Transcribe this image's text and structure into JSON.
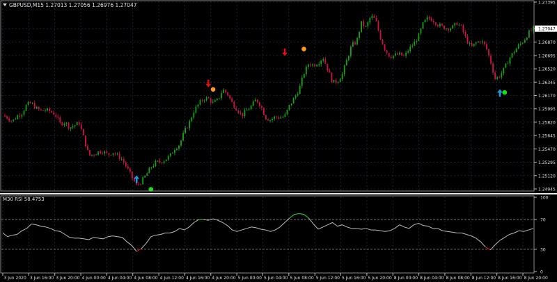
{
  "main": {
    "symbol_info": "GBPUSD,M15  1.27013 1.27056 1.26976 1.27047",
    "price_labels": [
      "1.27395",
      "1.27047",
      "1.26870",
      "1.26695",
      "1.26520",
      "1.26345",
      "1.26170",
      "1.25995",
      "1.25820",
      "1.25645",
      "1.25470",
      "1.25295",
      "1.25120",
      "1.24945"
    ],
    "current_price": "1.27047"
  },
  "indicator": {
    "label": "M30 RSI 58.4753",
    "levels": [
      "100",
      "70",
      "30",
      "0"
    ]
  },
  "time_labels": [
    "3 Jun 2020",
    "3 Jun 16:00",
    "3 Jun 20:00",
    "4 Jun 00:00",
    "4 Jun 04:00",
    "4 Jun 08:00",
    "4 Jun 12:00",
    "4 Jun 16:00",
    "4 Jun 20:00",
    "5 Jun 00:00",
    "5 Jun 04:00",
    "5 Jun 08:00",
    "5 Jun 12:00",
    "5 Jun 16:00",
    "5 Jun 20:00",
    "8 Jun 00:00",
    "8 Jun 04:00",
    "8 Jun 08:00",
    "8 Jun 12:00",
    "8 Jun 16:00",
    "8 Jun 20:00"
  ],
  "colors": {
    "background": "#000000",
    "grid": "#2a3a5a",
    "bull": "#16a316",
    "bear": "#d0104a",
    "arrow_up": "#1e9be0",
    "arrow_down": "#e01010",
    "dot_orange": "#ff9a1a",
    "dot_green": "#19e019",
    "rsi_line": "#bfbfbf",
    "rsi_over": "#33dd33",
    "rsi_under": "#e01010"
  },
  "chart_data": {
    "type": "candlestick",
    "symbol": "GBPUSD",
    "timeframe": "M15",
    "ohlc_header": {
      "open": 1.27013,
      "high": 1.27056,
      "low": 1.26976,
      "close": 1.27047
    },
    "ylim": [
      1.24945,
      1.27395
    ],
    "price_path": [
      [
        0,
        1.2591
      ],
      [
        1,
        1.2588
      ],
      [
        2,
        1.2583
      ],
      [
        3,
        1.259
      ],
      [
        4,
        1.2594
      ],
      [
        5,
        1.2605
      ],
      [
        6,
        1.2607
      ],
      [
        7,
        1.26
      ],
      [
        8,
        1.2597
      ],
      [
        9,
        1.2598
      ],
      [
        10,
        1.2596
      ],
      [
        11,
        1.2592
      ],
      [
        12,
        1.258
      ],
      [
        13,
        1.2582
      ],
      [
        14,
        1.2575
      ],
      [
        15,
        1.2578
      ],
      [
        16,
        1.2581
      ],
      [
        17,
        1.256
      ],
      [
        18,
        1.2538
      ],
      [
        19,
        1.254
      ],
      [
        20,
        1.2543
      ],
      [
        21,
        1.2544
      ],
      [
        22,
        1.2539
      ],
      [
        23,
        1.2543
      ],
      [
        24,
        1.2538
      ],
      [
        25,
        1.2533
      ],
      [
        26,
        1.2522
      ],
      [
        27,
        1.251
      ],
      [
        28,
        1.2499
      ],
      [
        29,
        1.2504
      ],
      [
        30,
        1.2513
      ],
      [
        31,
        1.2523
      ],
      [
        32,
        1.2529
      ],
      [
        33,
        1.253
      ],
      [
        34,
        1.2533
      ],
      [
        35,
        1.2538
      ],
      [
        36,
        1.2548
      ],
      [
        37,
        1.2553
      ],
      [
        38,
        1.257
      ],
      [
        39,
        1.2581
      ],
      [
        40,
        1.2597
      ],
      [
        41,
        1.2606
      ],
      [
        42,
        1.2613
      ],
      [
        43,
        1.2613
      ],
      [
        44,
        1.2607
      ],
      [
        45,
        1.2611
      ],
      [
        46,
        1.2625
      ],
      [
        47,
        1.2619
      ],
      [
        48,
        1.2607
      ],
      [
        49,
        1.2599
      ],
      [
        50,
        1.2591
      ],
      [
        51,
        1.2597
      ],
      [
        52,
        1.2603
      ],
      [
        53,
        1.2612
      ],
      [
        54,
        1.2603
      ],
      [
        55,
        1.2588
      ],
      [
        56,
        1.2585
      ],
      [
        57,
        1.2589
      ],
      [
        58,
        1.2588
      ],
      [
        59,
        1.259
      ],
      [
        60,
        1.2604
      ],
      [
        61,
        1.2614
      ],
      [
        62,
        1.2625
      ],
      [
        63,
        1.2646
      ],
      [
        64,
        1.2659
      ],
      [
        65,
        1.2657
      ],
      [
        66,
        1.266
      ],
      [
        67,
        1.2667
      ],
      [
        68,
        1.2651
      ],
      [
        69,
        1.2634
      ],
      [
        70,
        1.2636
      ],
      [
        71,
        1.2644
      ],
      [
        72,
        1.2664
      ],
      [
        73,
        1.2683
      ],
      [
        74,
        1.2687
      ],
      [
        75,
        1.2712
      ],
      [
        76,
        1.2706
      ],
      [
        77,
        1.2721
      ],
      [
        78,
        1.2716
      ],
      [
        79,
        1.2693
      ],
      [
        80,
        1.2677
      ],
      [
        81,
        1.2668
      ],
      [
        82,
        1.267
      ],
      [
        83,
        1.2671
      ],
      [
        84,
        1.2668
      ],
      [
        85,
        1.2678
      ],
      [
        86,
        1.2685
      ],
      [
        87,
        1.2695
      ],
      [
        88,
        1.2712
      ],
      [
        89,
        1.2719
      ],
      [
        90,
        1.2716
      ],
      [
        91,
        1.271
      ],
      [
        92,
        1.2707
      ],
      [
        93,
        1.2705
      ],
      [
        94,
        1.2706
      ],
      [
        95,
        1.2712
      ],
      [
        96,
        1.2706
      ],
      [
        97,
        1.269
      ],
      [
        98,
        1.268
      ],
      [
        99,
        1.2686
      ],
      [
        100,
        1.2689
      ],
      [
        101,
        1.2682
      ],
      [
        102,
        1.2663
      ],
      [
        103,
        1.2639
      ],
      [
        104,
        1.2643
      ],
      [
        105,
        1.2653
      ],
      [
        106,
        1.2666
      ],
      [
        107,
        1.2675
      ],
      [
        108,
        1.2683
      ],
      [
        109,
        1.2689
      ],
      [
        110,
        1.2699
      ],
      [
        111,
        1.2704
      ]
    ],
    "signals": [
      {
        "type": "arrow_up",
        "index": 28,
        "price": 1.2505
      },
      {
        "type": "arrow_down",
        "index": 43,
        "price": 1.2635
      },
      {
        "type": "dot_orange",
        "index": 44,
        "price": 1.2625
      },
      {
        "type": "arrow_down",
        "index": 59,
        "price": 1.2676
      },
      {
        "type": "dot_orange",
        "index": 63,
        "price": 1.2678
      },
      {
        "type": "arrow_up",
        "index": 104,
        "price": 1.2618
      },
      {
        "type": "dot_green",
        "index": 105,
        "price": 1.2621
      },
      {
        "type": "dot_green",
        "index": 31,
        "price": 1.2494
      }
    ],
    "rsi": {
      "ylim": [
        0,
        100
      ],
      "levels": [
        30,
        70
      ],
      "values": [
        52,
        47,
        49,
        50,
        55,
        58,
        64,
        63,
        61,
        60,
        58,
        55,
        54,
        50,
        46,
        45,
        45,
        44,
        43,
        46,
        45,
        44,
        47,
        48,
        47,
        46,
        40,
        35,
        27,
        31,
        38,
        47,
        49,
        50,
        52,
        52,
        54,
        58,
        56,
        60,
        66,
        70,
        70,
        69,
        71,
        69,
        66,
        62,
        56,
        54,
        56,
        58,
        60,
        59,
        57,
        56,
        54,
        56,
        60,
        66,
        72,
        77,
        78,
        77,
        72,
        64,
        57,
        60,
        63,
        66,
        61,
        63,
        60,
        58,
        58,
        57,
        58,
        56,
        56,
        55,
        54,
        55,
        58,
        63,
        60,
        58,
        63,
        65,
        62,
        61,
        58,
        58,
        55,
        54,
        53,
        52,
        52,
        50,
        48,
        45,
        40,
        33,
        29,
        36,
        42,
        46,
        50,
        52,
        55,
        54,
        56,
        58
      ]
    }
  }
}
